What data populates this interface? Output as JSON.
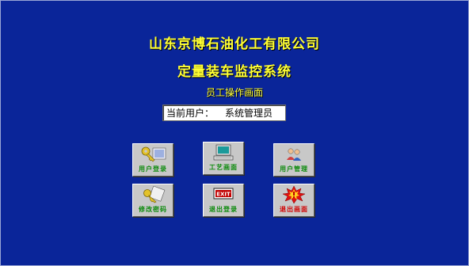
{
  "header": {
    "company": "山东京博石油化工有限公司",
    "system": "定量装车监控系统",
    "screen": "员工操作画面"
  },
  "user": {
    "label": "当前用户：",
    "value": "系统管理员"
  },
  "buttons": [
    {
      "label": "用户登录",
      "icon": "key-user-icon",
      "color": "#0b8a0b"
    },
    {
      "label": "工艺画面",
      "icon": "computer-icon",
      "color": "#0b8a0b"
    },
    {
      "label": "用户管理",
      "icon": "users-icon",
      "color": "#0b8a0b"
    },
    {
      "label": "修改密码",
      "icon": "password-key-icon",
      "color": "#0b8a0b"
    },
    {
      "label": "退出登录",
      "icon": "exit-sign-icon",
      "color": "#0b8a0b"
    },
    {
      "label": "退出画面",
      "icon": "alert-burst-icon",
      "color": "#d00000"
    }
  ]
}
